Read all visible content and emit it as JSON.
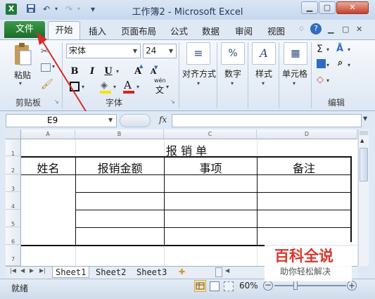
{
  "window": {
    "title": "工作簿2 - Microsoft Excel",
    "app_icon": "X",
    "minimize": "▁",
    "maximize": "▢",
    "close": "✕"
  },
  "quick_access": {
    "save_icon": "floppy",
    "undo": "↶",
    "redo": "↷",
    "customize": "▾"
  },
  "tabs": {
    "file": "文件",
    "items": [
      "开始",
      "插入",
      "页面布局",
      "公式",
      "数据",
      "审阅",
      "视图"
    ],
    "active": "开始"
  },
  "ribbon": {
    "clipboard": {
      "paste": "粘贴",
      "group_label": "剪贴板"
    },
    "font": {
      "font_name": "宋体",
      "font_size": "24",
      "bold": "B",
      "italic": "I",
      "underline": "U",
      "grow": "A",
      "shrink": "A",
      "font_color": "A",
      "wen": "wén",
      "wen_char": "文",
      "group_label": "字体"
    },
    "alignment": {
      "label": "对齐方式"
    },
    "number": {
      "label": "数字"
    },
    "styles": {
      "label": "样式"
    },
    "cells": {
      "label": "单元格"
    },
    "editing": {
      "group_label": "编辑"
    }
  },
  "formula_bar": {
    "name_box": "E9",
    "fx": "fx",
    "value": ""
  },
  "columns": [
    "A",
    "B",
    "C",
    "D"
  ],
  "rows": [
    "1",
    "2",
    "3",
    "4",
    "5",
    "6",
    "7"
  ],
  "sheet": {
    "title": "报 销 单",
    "headers": [
      "姓名",
      "报销金额",
      "事项",
      "备注"
    ]
  },
  "sheet_tabs": [
    "Sheet1",
    "Sheet2",
    "Sheet3"
  ],
  "active_sheet": "Sheet1",
  "status": {
    "ready": "就绪",
    "zoom": "60%"
  },
  "watermark": {
    "title": "百科全说",
    "subtitle": "助你轻松解决"
  },
  "colors": {
    "file_tab": "#2a8a3c",
    "annotation_arrow": "#d62b2b",
    "watermark_red": "#d8372d"
  }
}
